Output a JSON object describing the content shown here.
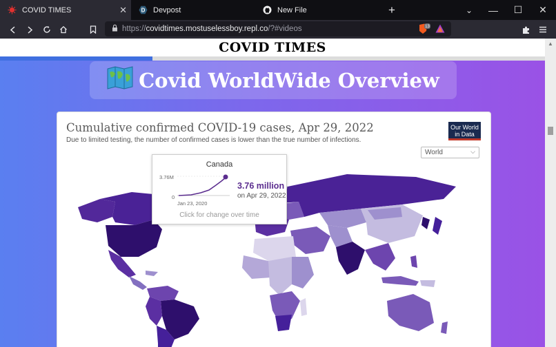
{
  "browser": {
    "tabs": [
      {
        "title": "COVID TIMES",
        "icon": "virus-icon",
        "active": true
      },
      {
        "title": "Devpost",
        "icon": "devpost-icon",
        "active": false
      },
      {
        "title": "New File",
        "icon": "github-icon",
        "active": false
      }
    ],
    "new_tab_label": "+",
    "url": {
      "scheme": "https://",
      "host": "covidtimes.mostuselessboy.repl.co",
      "path": "/?#videos"
    },
    "brave_badge": "13"
  },
  "page": {
    "masthead": "COVID TIMES",
    "progress_fraction": 0.28,
    "hero_title": "Covid WorldWide Overview",
    "chart": {
      "title": "Cumulative confirmed COVID-19 cases, Apr 29, 2022",
      "subtitle": "Due to limited testing, the number of confirmed cases is lower than the true number of infections.",
      "badge_line1": "Our World",
      "badge_line2": "in Data",
      "region_select": "World",
      "tooltip": {
        "country": "Canada",
        "value": "3.76 million",
        "date": "on Apr 29, 2022",
        "ymax": "3.76M",
        "ymin": "0",
        "xstart": "Jan 23, 2020",
        "hint": "Click for change over time"
      }
    }
  },
  "colors": {
    "accent": "#5b2d8f",
    "gradient_start": "#5a7ff0",
    "gradient_end": "#9a52e6",
    "owid_navy": "#1a2a4f",
    "owid_red": "#c0392b"
  }
}
